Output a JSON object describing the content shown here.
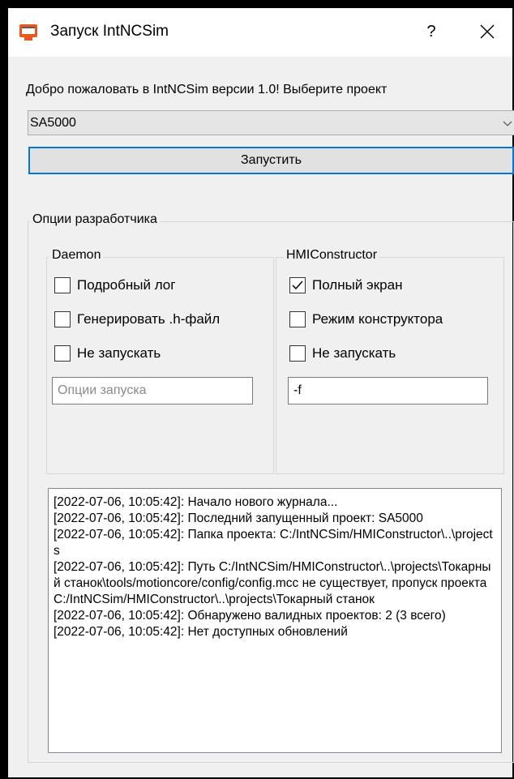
{
  "window": {
    "title": "Запуск IntNCSim",
    "help_label": "?"
  },
  "welcome_text": "Добро пожаловать в IntNCSim версии 1.0! Выберите проект",
  "project_select": {
    "value": "SA5000"
  },
  "run_button": {
    "label": "Запустить"
  },
  "dev_options": {
    "title": "Опции разработчика",
    "daemon": {
      "title": "Daemon",
      "checkboxes": [
        {
          "label": "Подробный лог",
          "checked": false
        },
        {
          "label": "Генерировать .h-файл",
          "checked": false
        },
        {
          "label": "Не запускать",
          "checked": false
        }
      ],
      "input": {
        "value": "",
        "placeholder": "Опции запуска"
      }
    },
    "hmi": {
      "title": "HMIConstructor",
      "checkboxes": [
        {
          "label": "Полный экран",
          "checked": true
        },
        {
          "label": "Режим конструктора",
          "checked": false
        },
        {
          "label": "Не запускать",
          "checked": false
        }
      ],
      "input": {
        "value": "-f",
        "placeholder": ""
      }
    }
  },
  "log": [
    "[2022-07-06, 10:05:42]: Начало нового журнала...",
    "[2022-07-06, 10:05:42]: Последний запущенный проект: SA5000",
    "[2022-07-06, 10:05:42]: Папка проекта: C:/IntNCSim/HMIConstructor\\..\\projects",
    "[2022-07-06, 10:05:42]: Путь C:/IntNCSim/HMIConstructor\\..\\projects\\Токарный станок\\tools/motioncore/config/config.mcc не существует, пропуск проекта C:/IntNCSim/HMIConstructor\\..\\projects\\Токарный станок",
    "[2022-07-06, 10:05:42]: Обнаружено валидных проектов: 2 (3 всего)",
    "[2022-07-06, 10:05:42]: Нет доступных обновлений"
  ],
  "colors": {
    "accent": "#0078d7",
    "window_bg": "#f0f0f0",
    "icon_orange": "#e8581c"
  },
  "icons": {
    "app": "terminal-window-icon",
    "help": "question-mark",
    "close": "x-icon",
    "dropdown": "chevron-down-icon",
    "check": "checkmark-icon"
  }
}
